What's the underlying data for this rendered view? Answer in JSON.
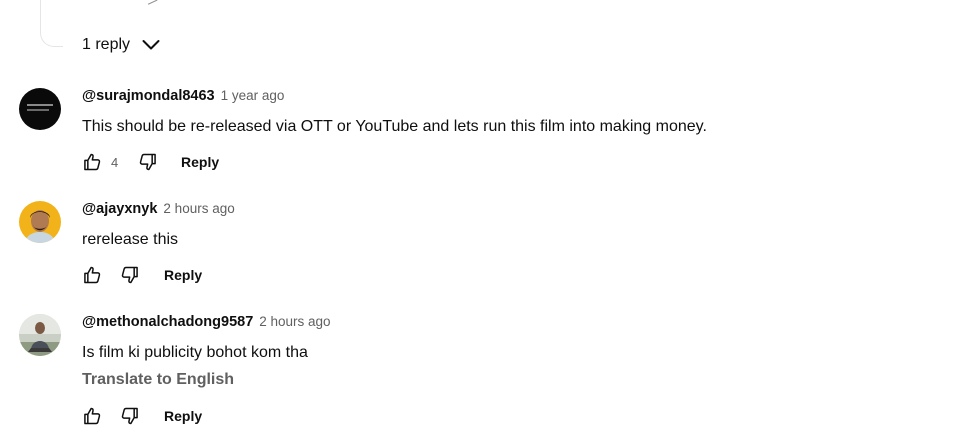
{
  "thread": {
    "replies_toggle_label": "1 reply"
  },
  "comments": [
    {
      "handle": "@surajmondal8463",
      "time": "1 year ago",
      "text": "This should be re-released via OTT or YouTube and lets run this film into making money.",
      "likes": "4",
      "reply_label": "Reply",
      "avatar_icon": "black-thumbnail-avatar"
    },
    {
      "handle": "@ajayxnyk",
      "time": "2 hours ago",
      "text": "rerelease this",
      "likes": "",
      "reply_label": "Reply",
      "avatar_icon": "person-photo-avatar"
    },
    {
      "handle": "@methonalchadong9587",
      "time": "2 hours ago",
      "text": "Is film ki publicity bohot kom tha",
      "translate_label": "Translate to English",
      "likes": "",
      "reply_label": "Reply",
      "avatar_icon": "person-outdoor-avatar"
    }
  ],
  "colors": {
    "text_primary": "#0f0f0f",
    "text_secondary": "#606060",
    "divider": "#e5e5e5",
    "avatar_yellow": "#f2b21a"
  }
}
